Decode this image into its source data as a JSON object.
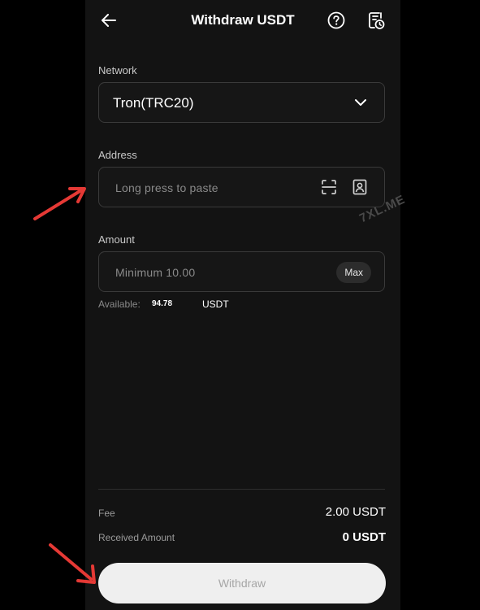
{
  "header": {
    "title": "Withdraw USDT",
    "back_icon": "arrow-left-icon",
    "help_icon": "question-circle-icon",
    "history_icon": "history-clock-icon"
  },
  "network": {
    "label": "Network",
    "value": "Tron(TRC20)",
    "icon": "chevron-down-icon"
  },
  "address": {
    "label": "Address",
    "placeholder": "Long press to paste",
    "scan_icon": "scan-icon",
    "address_book_icon": "address-book-icon"
  },
  "amount": {
    "label": "Amount",
    "placeholder": "Minimum 10.00",
    "max_label": "Max",
    "available_label": "Available:",
    "available_value": "94.78",
    "available_unit": "USDT"
  },
  "summary": {
    "fee_label": "Fee",
    "fee_value": "2.00 USDT",
    "received_label": "Received Amount",
    "received_value": "0 USDT"
  },
  "actions": {
    "withdraw_label": "Withdraw"
  },
  "overlay": {
    "watermark": "7XL.ME",
    "arrow_color": "#e53935"
  },
  "colors": {
    "background": "#000000",
    "surface": "#131313",
    "border": "#3a3a3a",
    "button_bg": "#efefef"
  }
}
